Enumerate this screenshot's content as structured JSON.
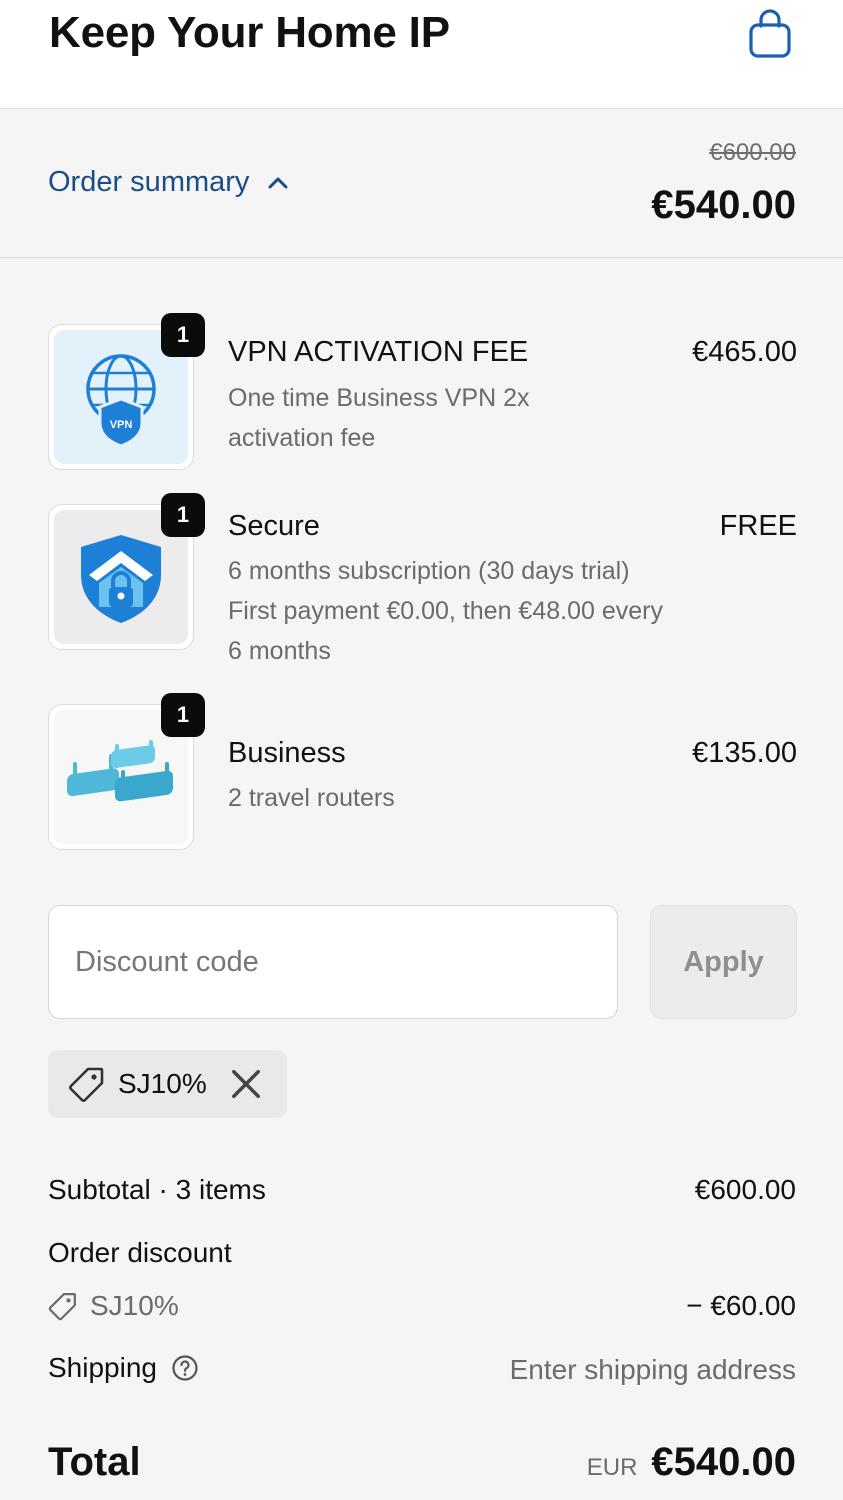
{
  "header": {
    "store_title": "Keep Your Home IP",
    "cart_icon": "shopping-bag-icon"
  },
  "summary": {
    "toggle_label": "Order summary",
    "toggle_icon": "chevron-up-icon",
    "original_price": "€600.00",
    "price": "€540.00"
  },
  "items": [
    {
      "quantity": "1",
      "name": "VPN ACTIVATION FEE",
      "description_lines": [
        "One time Business VPN 2x",
        "activation fee"
      ],
      "price": "€465.00",
      "image": "vpn-globe-shield-icon"
    },
    {
      "quantity": "1",
      "name": "Secure",
      "description_lines": [
        "6 months subscription (30 days trial)",
        "First payment €0.00, then €48.00 every",
        "6 months"
      ],
      "price": "FREE",
      "image": "house-shield-lock-icon"
    },
    {
      "quantity": "1",
      "name": "Business",
      "description_lines": [
        "2 travel routers"
      ],
      "price": "€135.00",
      "image": "travel-routers-image"
    }
  ],
  "discount": {
    "placeholder": "Discount code",
    "value": "",
    "apply_label": "Apply",
    "applied_code": "SJ10%"
  },
  "totals": {
    "subtotal_label": "Subtotal · 3 items",
    "subtotal_value": "€600.00",
    "order_discount_label": "Order discount",
    "discount_code": "SJ10%",
    "discount_value": "− €60.00",
    "shipping_label": "Shipping",
    "shipping_value": "Enter shipping address",
    "total_label": "Total",
    "currency": "EUR",
    "total_value": "€540.00"
  },
  "colors": {
    "link": "#1a4c86",
    "background": "#f5f5f5",
    "accent_blue": "#1d7fd6"
  }
}
